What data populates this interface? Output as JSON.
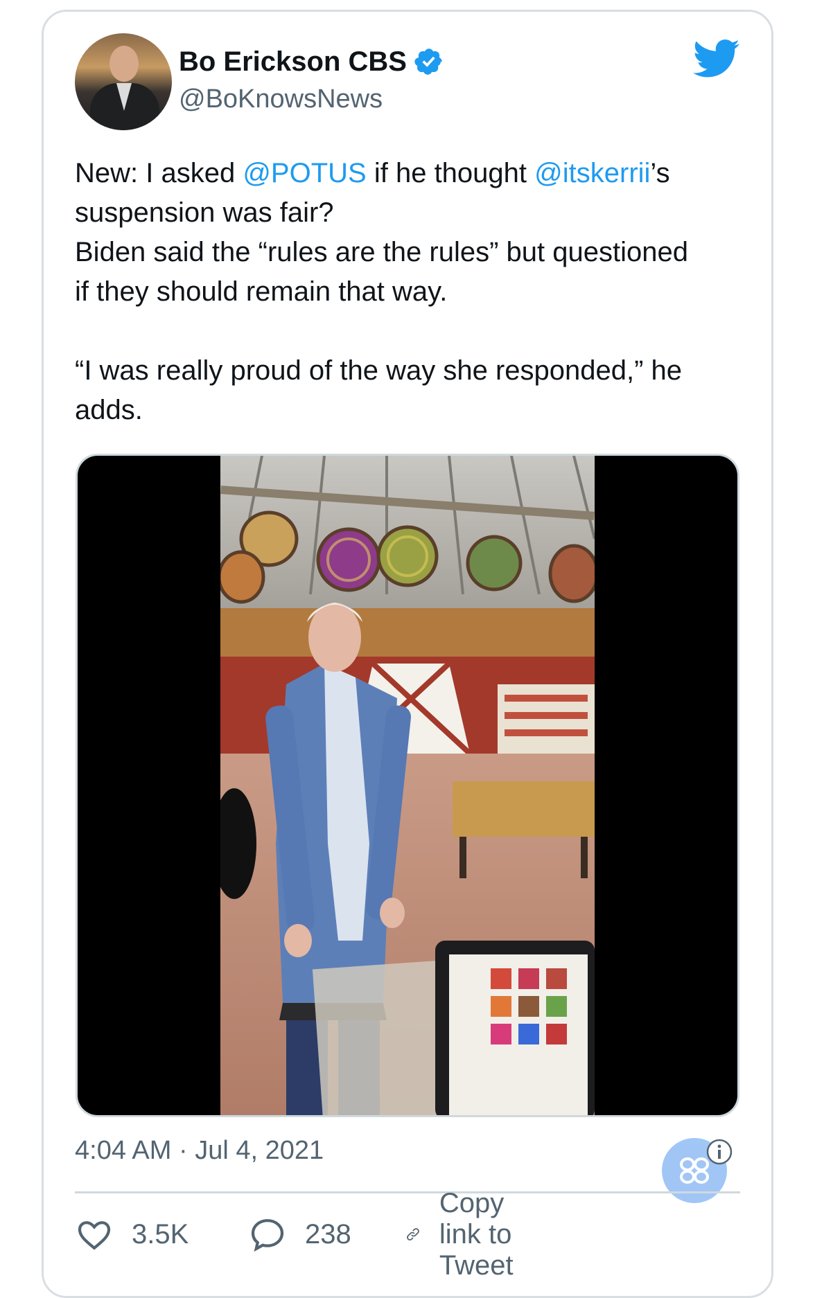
{
  "tweet": {
    "author_name": "Bo Erickson CBS",
    "handle": "@BoKnowsNews",
    "text": {
      "line1_a": "New: I asked ",
      "line1_mention1": "@POTUS",
      "line1_b": " if he thought ",
      "line1_mention2": "@itskerrii",
      "line1_c": "’s",
      "line2": "suspension was fair?",
      "line3": "Biden said the “rules are the rules” but questioned",
      "line4": "if they should remain that way.",
      "line5": "“I was really proud of the way she responded,” he",
      "line6": "adds."
    },
    "timestamp": "4:04 AM · Jul 4, 2021"
  },
  "actions": {
    "likes": "3.5K",
    "replies": "238",
    "copy_link": "Copy link to Tweet"
  },
  "icons": {
    "verified": "verified-badge-icon",
    "logo": "twitter-bird-icon",
    "like": "heart-icon",
    "reply": "speech-bubble-icon",
    "link": "link-icon",
    "info": "info-icon",
    "fab": "grid-menu-icon"
  },
  "colors": {
    "accent": "#1d9bf0",
    "secondary_text": "#536471",
    "border": "#cfd9de"
  }
}
